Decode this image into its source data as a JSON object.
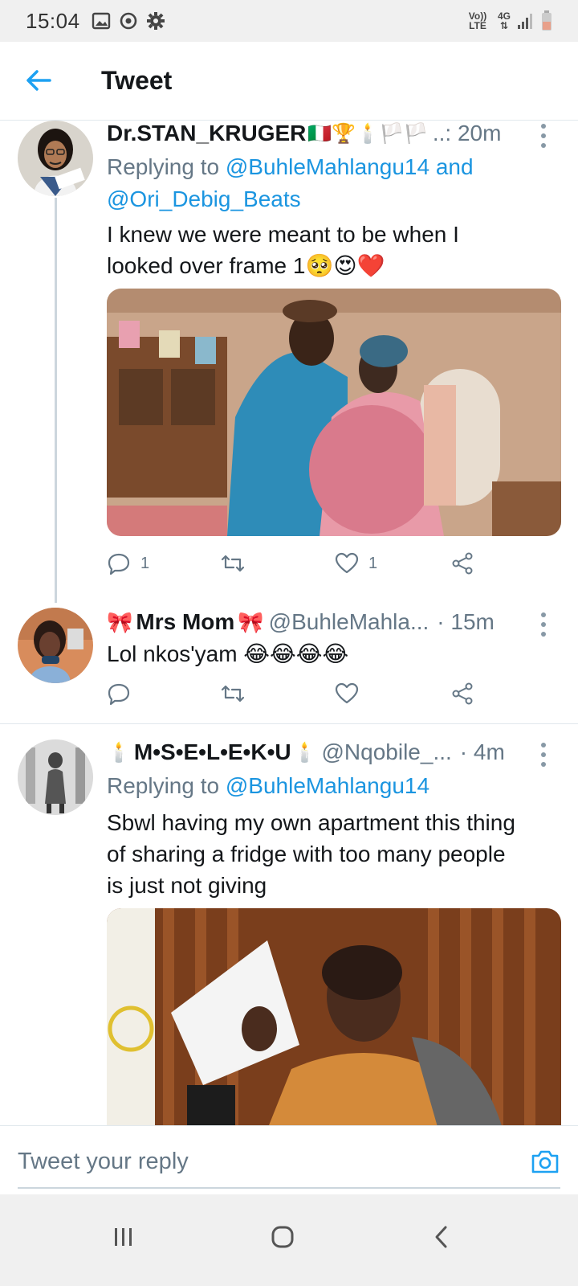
{
  "status_bar": {
    "time": "15:04",
    "network_top": "Vo)) LTE",
    "network_4g": "4G"
  },
  "header": {
    "title": "Tweet"
  },
  "tweets": [
    {
      "name": "Dr.STAN_KRUGER",
      "name_emojis": "🇮🇹🏆🕯️🏳️🏳️",
      "handle_time": "..: 20m",
      "replying_prefix": "Replying to ",
      "replying_to_1": "@BuhleMahlangu14",
      "replying_and": " and",
      "replying_to_2": "@Ori_Debig_Beats",
      "text_line1": "I knew we were meant to be when I",
      "text_line2": "looked over frame 1🥺😍❤️",
      "replies": "1",
      "retweets": "",
      "likes": "1"
    },
    {
      "name_prefix": "🎀",
      "name": "Mrs Mom",
      "name_suffix": "🎀",
      "handle": "@BuhleMahla...",
      "time": "· 15m",
      "text": "Lol nkos'yam 😂😂😂😂"
    },
    {
      "name_prefix": "🕯️",
      "name": "M•S•E•L•E•K•U",
      "name_suffix": "🕯️",
      "handle": "@Nqobile_...",
      "time": "· 4m",
      "replying_prefix": "Replying to ",
      "replying_to_1": "@BuhleMahlangu14",
      "text_line1": "Sbwl having my own apartment this thing",
      "text_line2": "of sharing a fridge with too many people",
      "text_line3": "is just not giving"
    }
  ],
  "reply_bar": {
    "placeholder": "Tweet your reply"
  },
  "colors": {
    "accent": "#1b95e0",
    "secondary_text": "#657786",
    "divider": "#e1e8ed"
  }
}
